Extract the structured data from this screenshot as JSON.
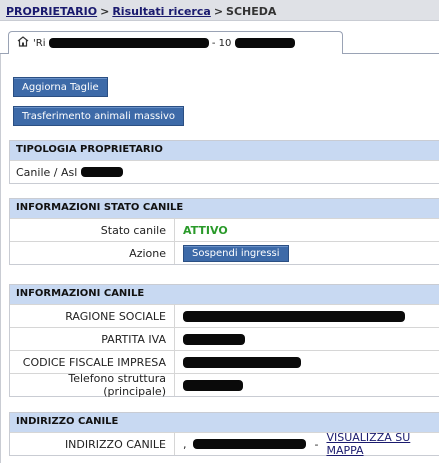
{
  "breadcrumb": {
    "items": [
      "PROPRIETARIO",
      "Risultati ricerca",
      "SCHEDA"
    ],
    "separator": ">"
  },
  "tab": {
    "label_prefix": "'Ri",
    "label_mid": "- 10",
    "icon": "home-icon"
  },
  "buttons": {
    "aggiorna": "Aggiorna Taglie",
    "trasferimento": "Trasferimento animali massivo"
  },
  "tipologia": {
    "title": "TIPOLOGIA PROPRIETARIO",
    "value_prefix": "Canile / Asl"
  },
  "stato": {
    "title": "INFORMAZIONI STATO CANILE",
    "stato_label": "Stato canile",
    "stato_value": "ATTIVO",
    "azione_label": "Azione",
    "azione_button": "Sospendi ingressi"
  },
  "canile": {
    "title": "INFORMAZIONI CANILE",
    "ragione_label": "RAGIONE SOCIALE",
    "piva_label": "PARTITA IVA",
    "cf_label": "CODICE FISCALE IMPRESA",
    "tel_label": "Telefono struttura (principale)"
  },
  "indirizzo": {
    "title": "INDIRIZZO CANILE",
    "label": "INDIRIZZO CANILE",
    "value_prefix": ",",
    "dash": "-",
    "map_link": "VISUALIZZA SU MAPPA"
  },
  "colors": {
    "accent": "#3d6aa8",
    "section_head": "#c8d9f2",
    "status_active": "#2a9a2a",
    "link": "#1a1a6e"
  }
}
